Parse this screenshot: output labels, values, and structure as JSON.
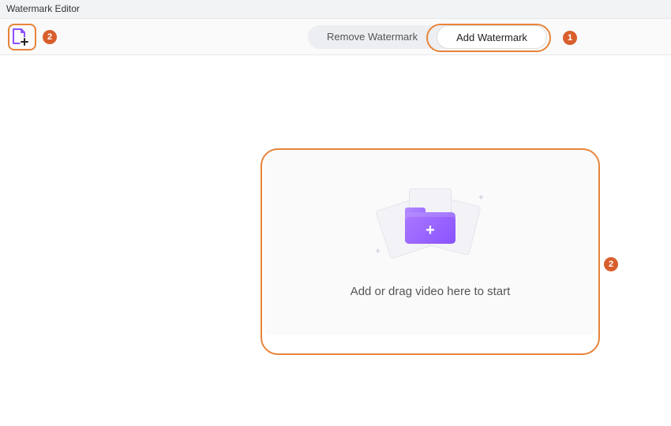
{
  "window": {
    "title": "Watermark Editor"
  },
  "toolbar": {
    "add_file_icon": "add-file-icon"
  },
  "tabs": {
    "remove": "Remove Watermark",
    "add": "Add Watermark"
  },
  "dropzone": {
    "prompt": "Add or drag video here to start"
  },
  "annotations": {
    "step1": "1",
    "step2": "2"
  }
}
